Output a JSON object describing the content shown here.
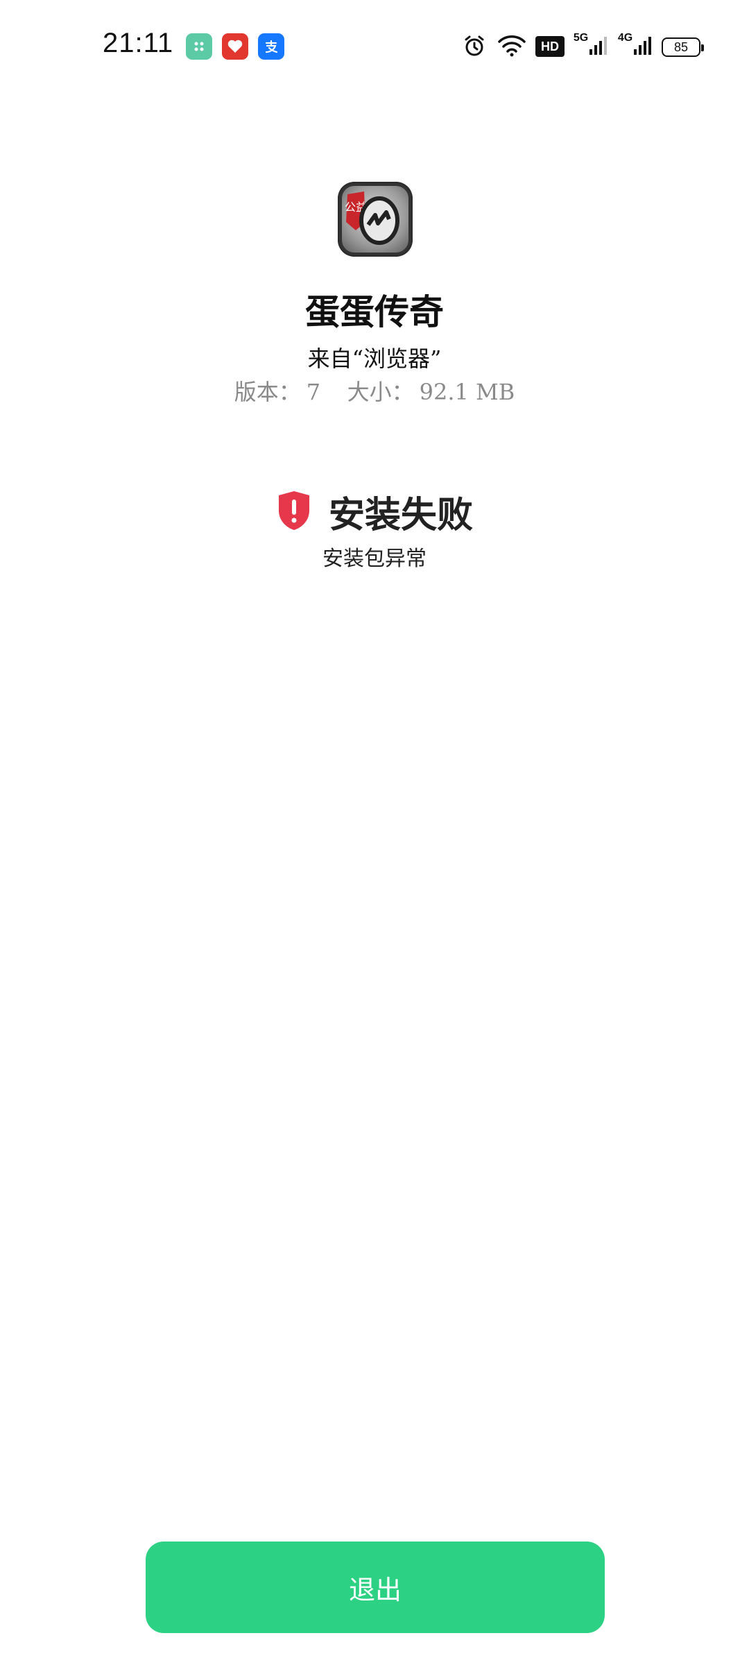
{
  "status_bar": {
    "time": "21:11",
    "notifications": [
      {
        "icon": "green-app-icon",
        "color": "#5ccaa5"
      },
      {
        "icon": "red-heart-app-icon",
        "color": "#e1372f"
      },
      {
        "icon": "alipay-icon",
        "color": "#1677ff"
      }
    ],
    "hd_label": "HD",
    "signal_5g_label": "5G",
    "signal_4g_label": "4G",
    "battery_level": "85"
  },
  "app": {
    "icon": "egg-legend-app-icon",
    "badge_text": "公益",
    "title": "蛋蛋传奇",
    "source": "来自“浏览器”",
    "version_label": "版本：",
    "version_value": "7",
    "size_label": "大小：",
    "size_value": "92.1 MB"
  },
  "install_status": {
    "icon": "warning-shield-icon",
    "icon_color": "#e5384a",
    "title": "安装失败",
    "message": "安装包异常"
  },
  "actions": {
    "exit_label": "退出",
    "button_color": "#2dd183"
  }
}
